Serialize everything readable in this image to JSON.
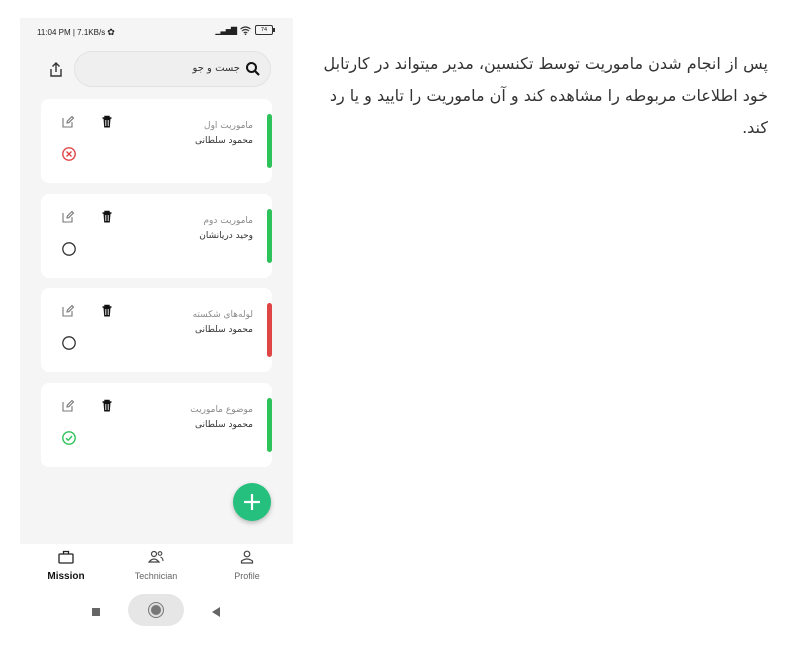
{
  "status_bar": {
    "time_speed": "11:04 PM | 7.1KB/s",
    "battery": "74"
  },
  "search": {
    "placeholder": "جست و جو"
  },
  "missions": [
    {
      "title": "ماموریت اول",
      "assignee": "محمود سلطانی",
      "status": "rejected",
      "bar_color": "#2ec25a"
    },
    {
      "title": "ماموریت دوم",
      "assignee": "وحید دریانشان",
      "status": "pending",
      "bar_color": "#2ec25a"
    },
    {
      "title": "لوله‌های شکسته",
      "assignee": "محمود سلطانی",
      "status": "pending",
      "bar_color": "#e04545"
    },
    {
      "title": "موضوع ماموریت",
      "assignee": "محمود سلطانی",
      "status": "approved",
      "bar_color": "#2ec25a"
    }
  ],
  "nav": [
    {
      "label": "Mission",
      "icon": "briefcase-icon",
      "active": true
    },
    {
      "label": "Technician",
      "icon": "users-icon",
      "active": false
    },
    {
      "label": "Profile",
      "icon": "person-icon",
      "active": false
    }
  ],
  "description": "پس از انجام شدن ماموریت توسط تکنسین، مدیر میتواند در کارتابل خود اطلاعات مربوطه را مشاهده کند و آن ماموریت را تایید و یا رد کند.",
  "colors": {
    "fab": "#25c07d",
    "reject": "#e04545",
    "approve": "#2ec25a"
  }
}
